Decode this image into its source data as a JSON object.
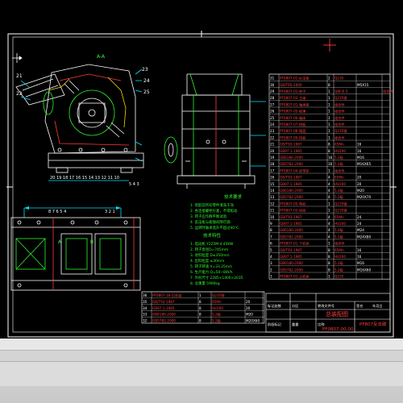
{
  "drawing": {
    "title_main": "总装配图",
    "drawing_no": "PF0807-00-00",
    "model": "PF807反击破",
    "title_row_labels": [
      "标记处数",
      "分区",
      "更改文件号",
      "签名",
      "年月日"
    ],
    "title_row_labels2": [
      "阶段标记",
      "重量",
      "比例"
    ],
    "view_letters": [
      "A",
      "B",
      "A",
      "B"
    ],
    "section_label": "A-A",
    "side_numbers_left": [
      "21",
      "22"
    ],
    "side_numbers_right": [
      "23",
      "24",
      "25"
    ],
    "bottom_numbers": "20 19 18 17 16 15 14 13 12 11 10",
    "bottom_right_numbers": "5 4 3",
    "plan_top_numbers": "8 7 6 5 4",
    "plan_top_right": "3 2 1",
    "tech_title": "技术要求",
    "tech_requirements": [
      "1. 装配前所有零件清洗干净.",
      "2. 各连接螺栓拧紧，不得松动.",
      "3. 转子应作静平衡试验.",
      "4. 反击板与板锤间隙可调.",
      "5. 运转时轴承温升不超过40℃."
    ],
    "tech_title2": "技术特性",
    "tech_specs": [
      "1. 电动机 Y225M-4    45KW",
      "2. 转子直径D=745mm",
      "3. 进料粒度 D≤350mm",
      "4. 出料粒度 ≤30mm",
      "5. 转子转速 V=33.25m/s",
      "6. 生产能力 Q=50~80t/h",
      "7. 外形尺寸 2285×1400×2035",
      "8. 总重量 5900kg"
    ]
  },
  "bom_right": [
    [
      "31",
      "PF0807-01-反击板",
      "2",
      "Q235",
      "",
      ""
    ],
    [
      "30",
      "GB/T65-2000",
      "8",
      "",
      "M5X15",
      ""
    ],
    [
      "29",
      "PF0807-01-转子",
      "1",
      "Q8F/0.5",
      "",
      "组合件"
    ],
    [
      "28",
      "PF0807-03-主轴",
      "1",
      "Q235钢",
      "",
      ""
    ],
    [
      "27",
      "PF0807-01-轴承座",
      "1",
      "组合件",
      "",
      ""
    ],
    [
      "26",
      "PF0807-05-板锤",
      "1",
      "组合件",
      "",
      ""
    ],
    [
      "25",
      "PF0807-06-箱体",
      "1",
      "组合件",
      "",
      ""
    ],
    [
      "24",
      "PF0807-07-侧板",
      "1",
      "组合件",
      "",
      ""
    ],
    [
      "23",
      "PF0807-08-锤盘",
      "1",
      "Q235钢",
      "",
      ""
    ],
    [
      "22",
      "PF0807-09-挡板",
      "1",
      "组合件",
      "",
      ""
    ],
    [
      "21",
      "GB/T93-1987",
      "8",
      "65Mn",
      "16",
      ""
    ],
    [
      "20",
      "GB97.1-1985",
      "8",
      "HV200",
      "16",
      ""
    ],
    [
      "19",
      "GB6180-2000",
      "16",
      "5.2级",
      "M16",
      ""
    ],
    [
      "18",
      "GB5782-2000",
      "16",
      "5.2级",
      "M16X65",
      ""
    ],
    [
      "17",
      "PF0807-04-皮带轮",
      "1",
      "组合件",
      "",
      ""
    ],
    [
      "16",
      "GB/T93-1987",
      "4",
      "65Mn",
      "20",
      ""
    ],
    [
      "15",
      "GB97.1-1985",
      "4",
      "HV200",
      "20",
      ""
    ],
    [
      "14",
      "GB6180-2000",
      "4",
      "5.2级",
      "M20",
      ""
    ],
    [
      "13",
      "GB5782-2000",
      "4",
      "5.2级",
      "M20X70",
      ""
    ],
    [
      "12",
      "PF0807-05-电机",
      "1",
      "Q235钢",
      "",
      ""
    ],
    [
      "11",
      "PF0807-03-机座",
      "1",
      "Q235钢",
      "",
      ""
    ],
    [
      "10",
      "GB/T93-1987",
      "4",
      "65Mn",
      "24",
      ""
    ],
    [
      "9",
      "GB97.1-1985",
      "4",
      "HV200",
      "24",
      ""
    ],
    [
      "8",
      "GB6180-2000",
      "4",
      "5.2级",
      "M24",
      ""
    ],
    [
      "7",
      "GB5782-2000",
      "4",
      "5.2级",
      "M24X80",
      ""
    ],
    [
      "6",
      "PF0807-01-下机体",
      "1",
      "组合件",
      "",
      ""
    ],
    [
      "5",
      "GB/T93-1987",
      "8",
      "65Mn",
      "16",
      ""
    ],
    [
      "4",
      "GB97.1-1985",
      "8",
      "HV200",
      "16",
      ""
    ],
    [
      "3",
      "GB6180-2000",
      "8",
      "5.2级",
      "M16",
      ""
    ],
    [
      "2",
      "GB5782-2000",
      "8",
      "5.2级",
      "M16X60",
      ""
    ],
    [
      "1",
      "PF0807-01-上机体",
      "1",
      "Q235",
      "",
      ""
    ]
  ],
  "bom_header": [
    "序号",
    "代号",
    "名称",
    "数量",
    "材料",
    "单件",
    "总计",
    "备注"
  ],
  "bom_lower": [
    [
      "36",
      "PF0807-18-后机架",
      "1",
      "Q235钢",
      "",
      ""
    ],
    [
      "35",
      "GB/T93-1987",
      "8",
      "65Mn",
      "20",
      ""
    ],
    [
      "34",
      "GB97.1-1985",
      "8",
      "HV200",
      "20",
      ""
    ],
    [
      "33",
      "GB6180-2000",
      "8",
      "5.2级",
      "M20",
      ""
    ],
    [
      "32",
      "GB5782-2000",
      "8",
      "5.2级",
      "M20X60",
      ""
    ]
  ],
  "colors": {
    "background": "#000000",
    "frame": "#ffffff",
    "geometry": "#ffffff",
    "hidden": "#ff3b3b",
    "annotation": "#2ff52f",
    "dimension": "#00e5ff",
    "title": "#ff3b3b",
    "statusbar": "#d4d4d4"
  },
  "icons": [
    "ucs-icon",
    "crosshair-cursor-icon"
  ]
}
